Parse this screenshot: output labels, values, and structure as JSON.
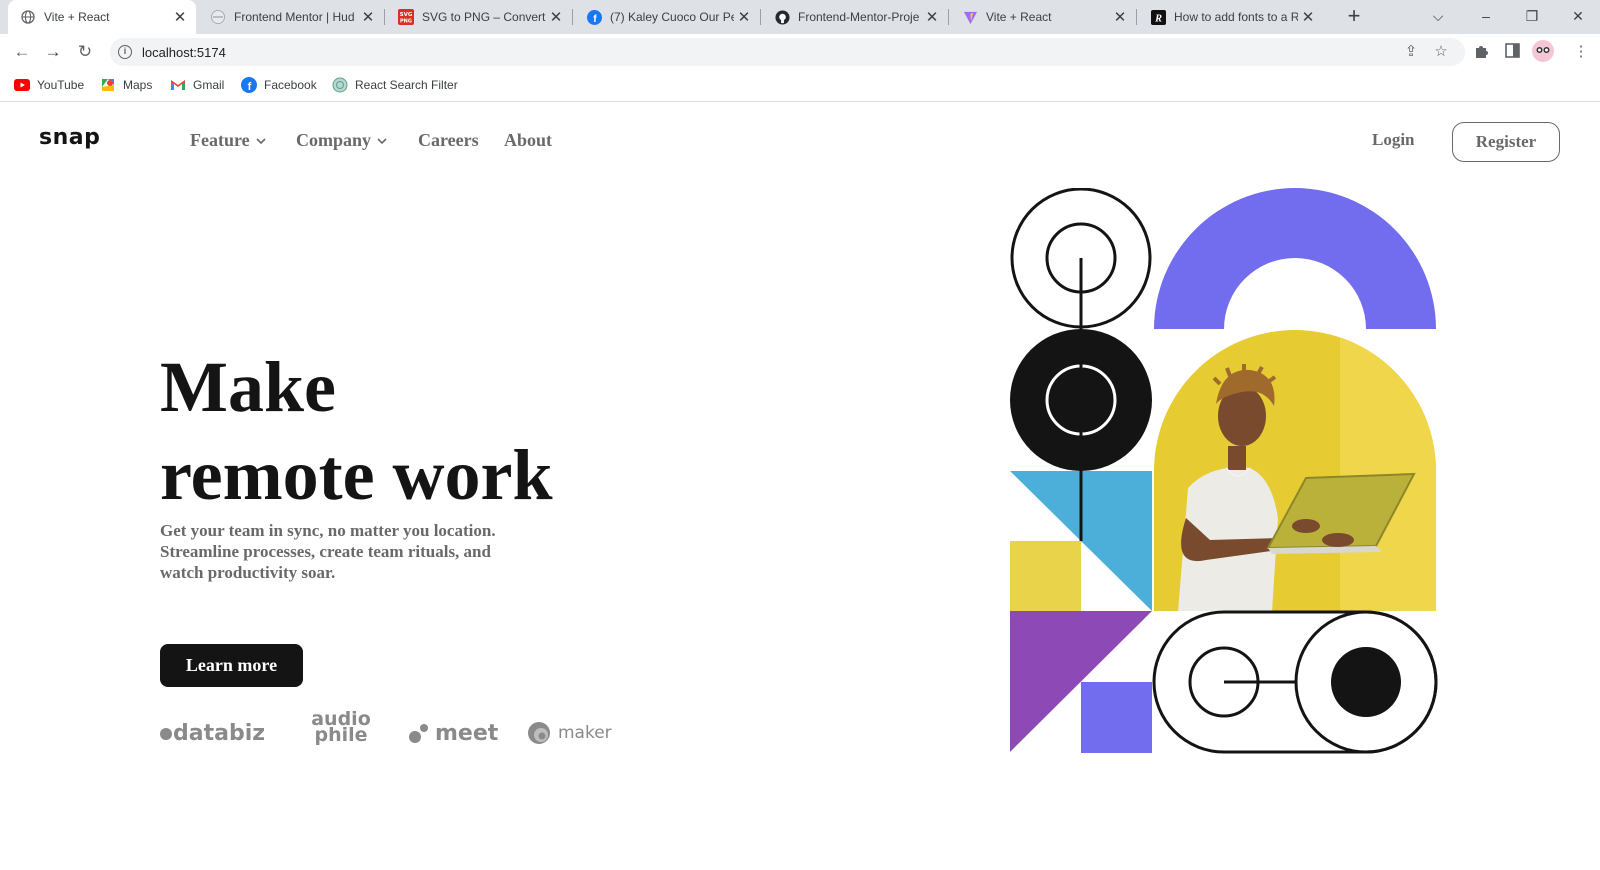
{
  "browser": {
    "tabs": [
      {
        "title": "Vite + React",
        "favicon": "globe-icon",
        "active": true
      },
      {
        "title": "Frontend Mentor | Hud",
        "favicon": "globe-icon"
      },
      {
        "title": "SVG to PNG – Convert S",
        "favicon": "svg-png-icon"
      },
      {
        "title": "(7) Kaley Cuoco Our Pe",
        "favicon": "facebook-icon"
      },
      {
        "title": "Frontend-Mentor-Proje",
        "favicon": "github-icon"
      },
      {
        "title": "Vite + React",
        "favicon": "vite-icon"
      },
      {
        "title": "How to add fonts to a R",
        "favicon": "r-logo-icon"
      }
    ],
    "url": "localhost:5174",
    "bookmarks": [
      {
        "label": "YouTube",
        "icon": "youtube-icon"
      },
      {
        "label": "Maps",
        "icon": "maps-icon"
      },
      {
        "label": "Gmail",
        "icon": "gmail-icon"
      },
      {
        "label": "Facebook",
        "icon": "facebook-icon"
      },
      {
        "label": "React Search Filter",
        "icon": "globe-icon"
      }
    ]
  },
  "site": {
    "logo": "snap",
    "nav": [
      {
        "label": "Feature",
        "has_dropdown": true
      },
      {
        "label": "Company",
        "has_dropdown": true
      },
      {
        "label": "Careers",
        "has_dropdown": false
      },
      {
        "label": "About",
        "has_dropdown": false
      }
    ],
    "login": "Login",
    "register": "Register"
  },
  "hero": {
    "title_line1": "Make",
    "title_line2": "remote work",
    "text": "Get your team in sync, no matter you location. Streamline processes, create team rituals, and watch productivity soar.",
    "button": "Learn more"
  },
  "clients": [
    "databiz",
    "audio phile",
    "meet",
    "maker"
  ],
  "colors": {
    "dark": "#141414",
    "gray": "#696969",
    "purple": "#726CEE",
    "yellow": "#E9D34B",
    "blue": "#4BAFD9",
    "violet": "#8D4AB6",
    "photo_bg": "#E6CB33"
  }
}
